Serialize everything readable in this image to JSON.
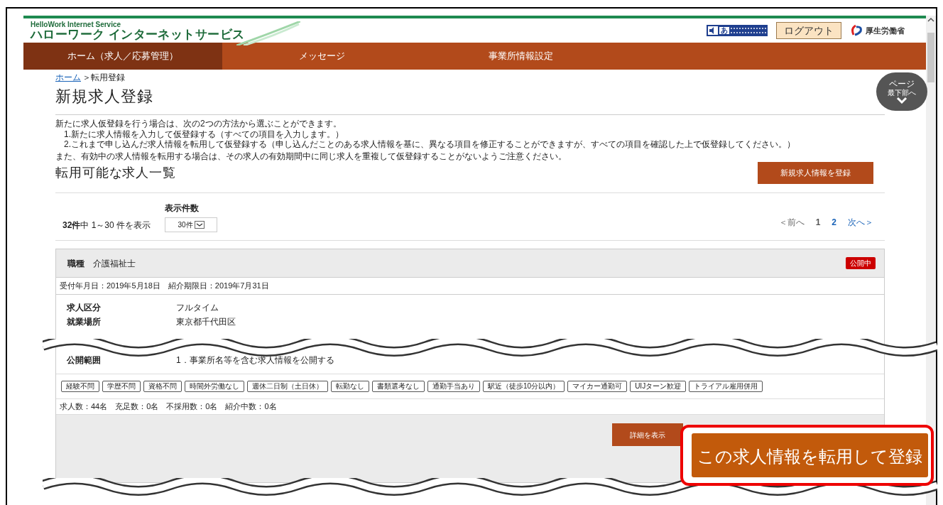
{
  "header": {
    "brand_en": "HelloWork Internet Service",
    "brand_ja": "ハローワーク インターネットサービス",
    "accessibility_mark": "あ",
    "logout": "ログアウト",
    "ministry": "厚生労働省"
  },
  "nav": [
    {
      "label": "ホーム（求人／応募管理）",
      "selected": true
    },
    {
      "label": "メッセージ",
      "selected": false
    },
    {
      "label": "事業所情報設定",
      "selected": false
    }
  ],
  "breadcrumb": {
    "home": "ホーム",
    "current": "＞転用登録"
  },
  "page_bottom_button": {
    "line_1": "ページ",
    "line_2": "最下部へ"
  },
  "title": "新規求人登録",
  "intro": {
    "lead": "新たに求人仮登録を行う場合は、次の2つの方法から選ぶことができます。",
    "options": [
      "1.新たに求人情報を入力して仮登録する（すべての項目を入力します。）",
      "2.これまで申し込んだ求人情報を転用して仮登録する（申し込んだことのある求人情報を基に、異なる項目を修正することができますが、すべての項目を確認した上で仮登録してください。）"
    ],
    "note": "また、有効中の求人情報を転用する場合は、その求人の有効期間中に同じ求人を重複して仮登録することがないようご注意ください。"
  },
  "section_title": "転用可能な求人一覧",
  "new_button": "新規求人情報を登録",
  "list_controls": {
    "count": "**32件**中 1～30 件を表示",
    "per_page_label": "表示件数",
    "per_page_value": "30件",
    "prev": "＜前へ",
    "pages": [
      {
        "label": "1",
        "selected": true
      },
      {
        "label": "2",
        "selected": false
      }
    ],
    "next": "次へ＞"
  },
  "job": {
    "occupation_label": "職種",
    "occupation": "介護福祉士",
    "status": "公開中",
    "dates": "受付年月日：2019年5月18日　紹介期限日：2019年7月31日",
    "fields": [
      {
        "label": "求人区分",
        "value": "フルタイム"
      },
      {
        "label": "就業場所",
        "value": "東京都千代田区"
      }
    ],
    "fields_after_break": [
      {
        "label": "公開範囲",
        "value": "1．事業所名等を含む求人情報を公開する"
      }
    ],
    "tags": [
      "経験不問",
      "学歴不問",
      "資格不問",
      "時間外労働なし",
      "週休二日制（土日休）",
      "転勤なし",
      "書類選考なし",
      "通勤手当あり",
      "駅近（徒歩10分以内）",
      "マイカー通勤可",
      "UIJターン歓迎",
      "トライアル雇用併用"
    ],
    "stats": "求人数：44名　充足数：0名　不採用数：0名　紹介中数：0名",
    "detail_button": "詳細を表示"
  },
  "callout_button": "この求人情報を転用して登録"
}
